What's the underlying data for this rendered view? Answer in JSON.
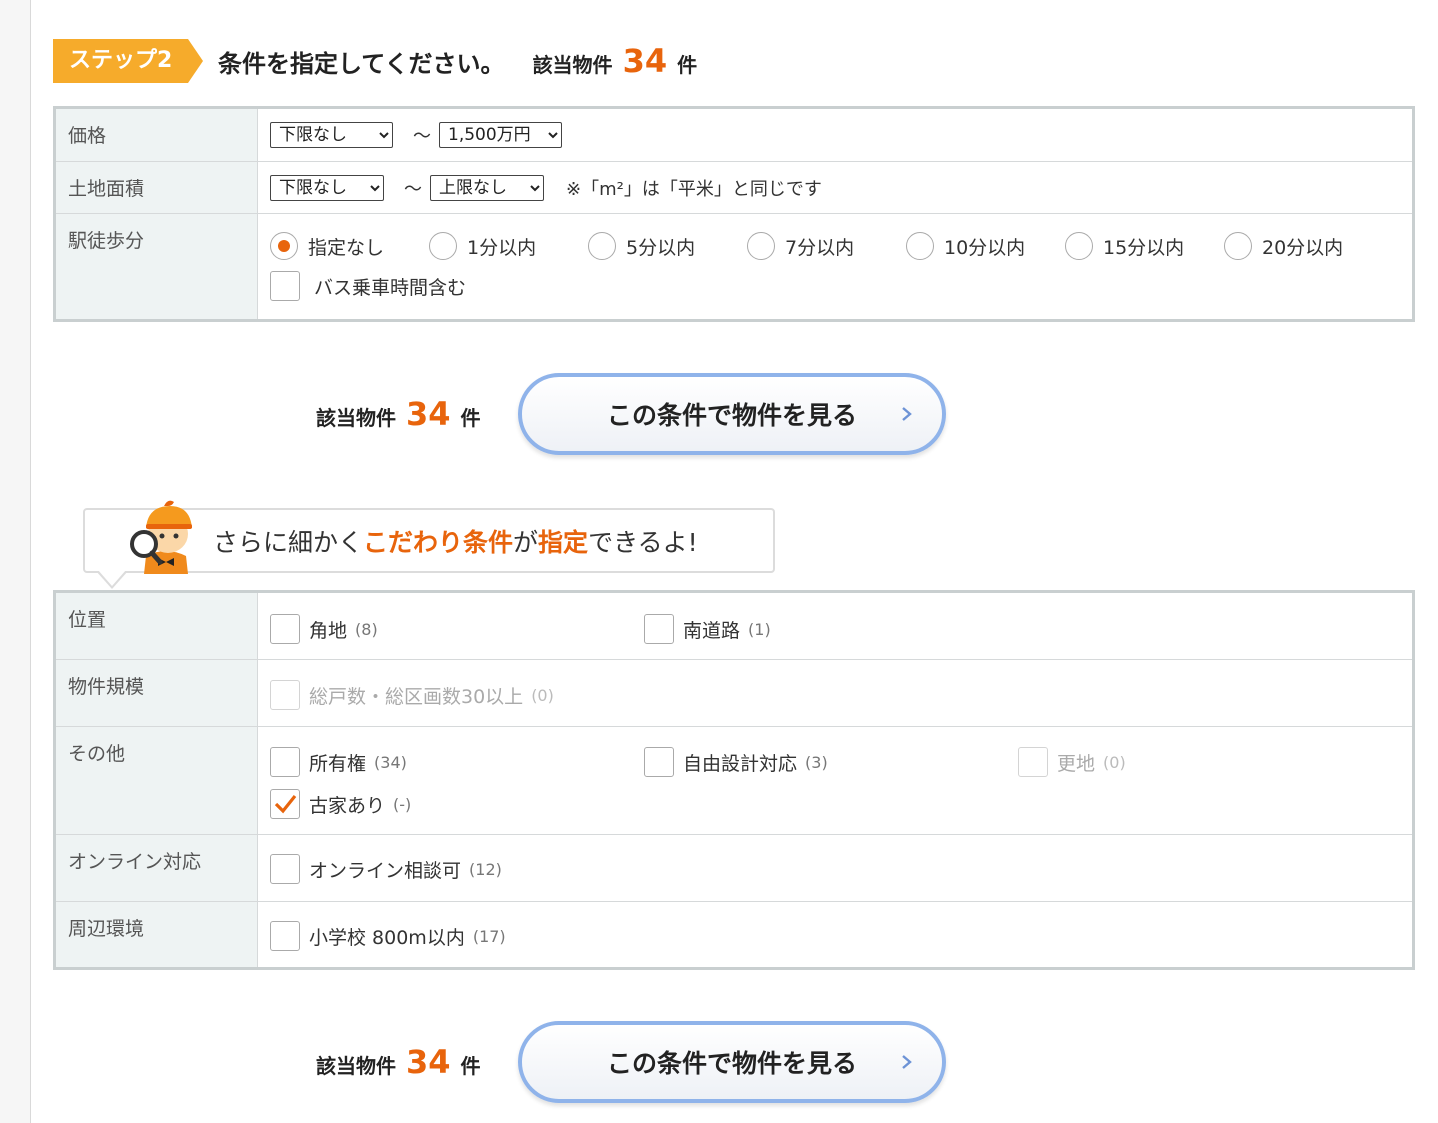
{
  "step": {
    "badge": "ステップ2",
    "title": "条件を指定してください。",
    "hit_prefix": "該当物件",
    "hit_count": "34",
    "hit_suffix": "件"
  },
  "conditions": {
    "price": {
      "label": "価格",
      "min": "下限なし",
      "tilde": "〜",
      "max": "1,500万円"
    },
    "land_area": {
      "label": "土地面積",
      "min": "下限なし",
      "tilde": "〜",
      "max": "上限なし",
      "note": "※「m²」は「平米」と同じです"
    },
    "walk": {
      "label": "駅徒歩分",
      "options": [
        {
          "label": "指定なし",
          "selected": true
        },
        {
          "label": "1分以内",
          "selected": false
        },
        {
          "label": "5分以内",
          "selected": false
        },
        {
          "label": "7分以内",
          "selected": false
        },
        {
          "label": "10分以内",
          "selected": false
        },
        {
          "label": "15分以内",
          "selected": false
        },
        {
          "label": "20分以内",
          "selected": false
        }
      ],
      "bus_label": "バス乗車時間含む",
      "bus_checked": false
    }
  },
  "result": {
    "prefix": "該当物件",
    "count": "34",
    "suffix": "件",
    "button": "この条件で物件を見る"
  },
  "banner": {
    "part1": "さらに細かく",
    "part2": "こだわり条件",
    "part3": "が",
    "part4": "指定",
    "part5": "できるよ!"
  },
  "details": {
    "position": {
      "label": "位置",
      "items": [
        {
          "label": "角地",
          "count": "(8)",
          "checked": false
        },
        {
          "label": "南道路",
          "count": "(1)",
          "checked": false
        }
      ]
    },
    "scale": {
      "label": "物件規模",
      "items": [
        {
          "label": "総戸数・総区画数30以上",
          "count": "(0)",
          "checked": false,
          "disabled": true
        }
      ]
    },
    "other": {
      "label": "その他",
      "items": [
        {
          "label": "所有権",
          "count": "(34)",
          "checked": false
        },
        {
          "label": "自由設計対応",
          "count": "(3)",
          "checked": false
        },
        {
          "label": "更地",
          "count": "(0)",
          "checked": false,
          "disabled": true
        },
        {
          "label": "古家あり",
          "count": "(-)",
          "checked": true
        }
      ]
    },
    "online": {
      "label": "オンライン対応",
      "items": [
        {
          "label": "オンライン相談可",
          "count": "(12)",
          "checked": false
        }
      ]
    },
    "surroundings": {
      "label": "周辺環境",
      "items": [
        {
          "label": "小学校 800m以内",
          "count": "(17)",
          "checked": false
        }
      ]
    }
  },
  "colors": {
    "accent": "#e8640c",
    "step_badge": "#f6ab2b",
    "button_border": "#8fb3ea",
    "header_cell": "#eef3f3"
  }
}
